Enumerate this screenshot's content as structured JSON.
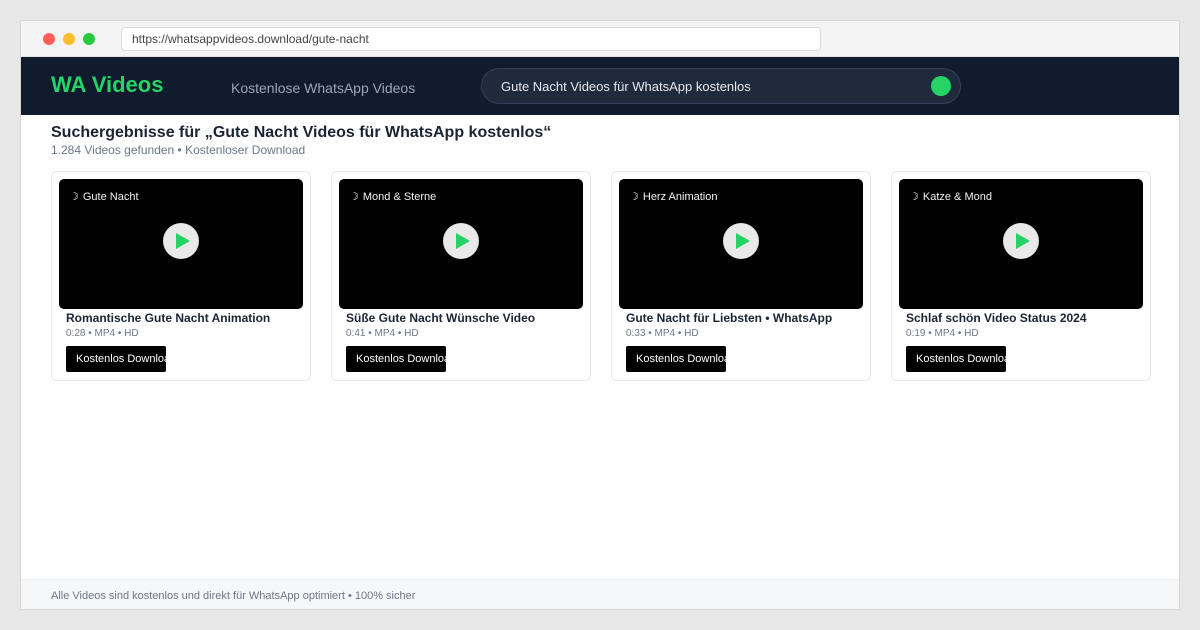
{
  "browser": {
    "url": "https://whatsappvideos.download/gute-nacht"
  },
  "header": {
    "logo": "WA Videos",
    "tagline": "Kostenlose WhatsApp Videos",
    "search_value": "Gute Nacht Videos für WhatsApp kostenlos"
  },
  "results": {
    "title": "Suchergebnisse für „Gute Nacht Videos für WhatsApp kostenlos“",
    "subtitle": "1.284 Videos gefunden • Kostenloser Download"
  },
  "videos": [
    {
      "tag": "Gute Nacht",
      "title": "Romantische Gute Nacht Animation",
      "meta": "0:28 • MP4 • HD",
      "button": "Kostenlos Download"
    },
    {
      "tag": "Mond & Sterne",
      "title": "Süße Gute Nacht Wünsche Video",
      "meta": "0:41 • MP4 • HD",
      "button": "Kostenlos Download"
    },
    {
      "tag": "Herz Animation",
      "title": "Gute Nacht für Liebsten • WhatsApp",
      "meta": "0:33 • MP4 • HD",
      "button": "Kostenlos Download"
    },
    {
      "tag": "Katze & Mond",
      "title": "Schlaf schön Video Status 2024",
      "meta": "0:19 • MP4 • HD",
      "button": "Kostenlos Download"
    }
  ],
  "footer": {
    "text": "Alle Videos sind kostenlos und direkt für WhatsApp optimiert • 100% sicher"
  },
  "icons": {
    "thumb_tag": "moon-icon",
    "thumb_center": "play-icon"
  },
  "colors": {
    "brand": "#25d366",
    "header_bg": "#111b2e"
  }
}
